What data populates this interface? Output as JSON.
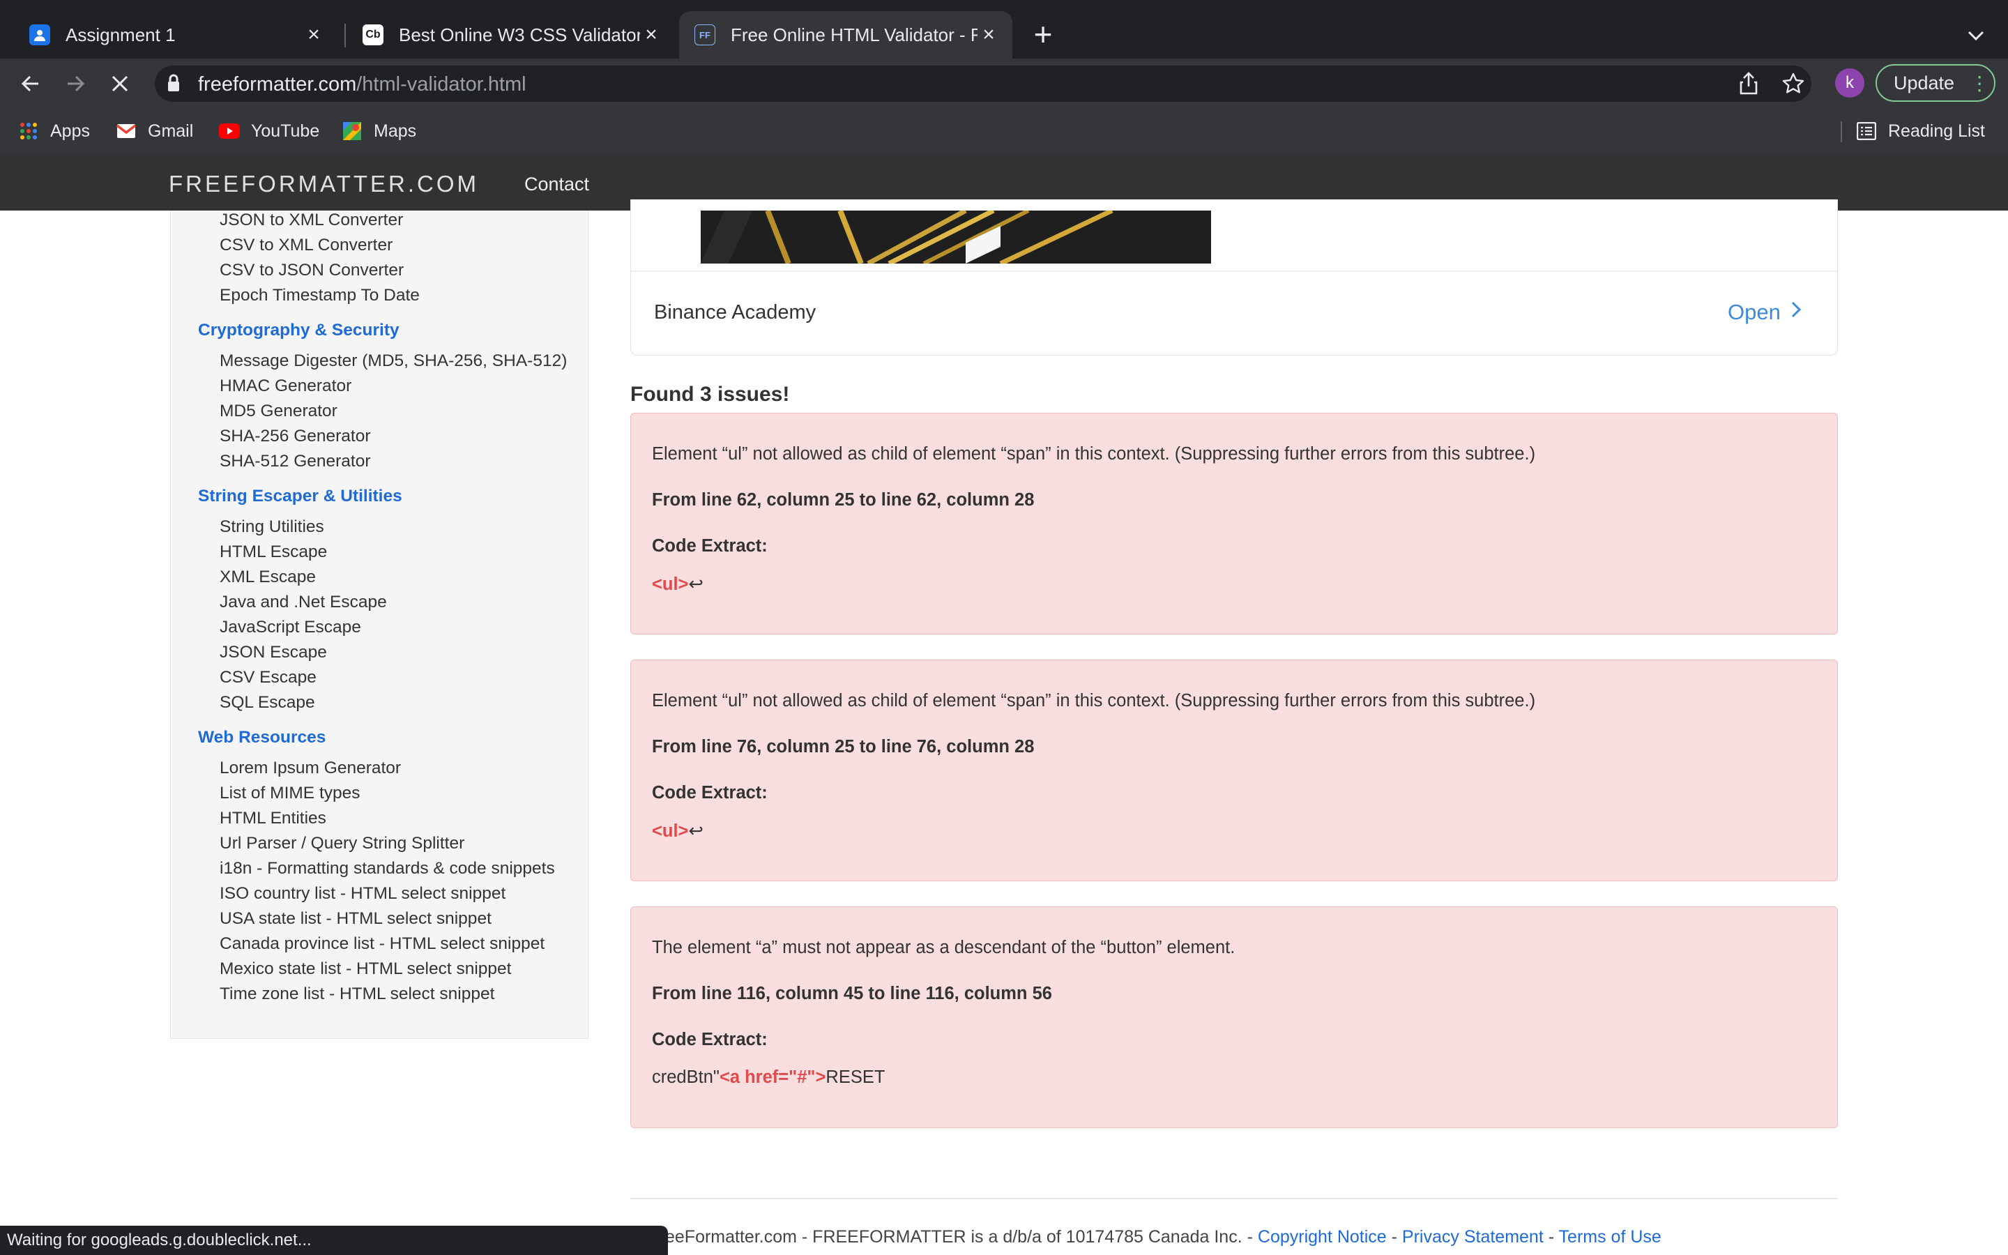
{
  "browser": {
    "tabs": [
      {
        "title": "Assignment 1",
        "active": false
      },
      {
        "title": "Best Online W3 CSS Validator",
        "favicon_text": "Cb",
        "active": false
      },
      {
        "title": "Free Online HTML Validator - F",
        "favicon_text": "FF",
        "active": true
      }
    ],
    "url_domain": "freeformatter.com",
    "url_path": "/html-validator.html",
    "profile_initial": "k",
    "update_label": "Update",
    "bookmarks": [
      "Apps",
      "Gmail",
      "YouTube",
      "Maps"
    ],
    "reading_list": "Reading List",
    "status_text": "Waiting for googleads.g.doubleclick.net..."
  },
  "site": {
    "brand": "FREEFORMATTER.COM",
    "nav_contact": "Contact"
  },
  "sidebar": {
    "top_items": [
      "JSON to XML Converter",
      "CSV to XML Converter",
      "CSV to JSON Converter",
      "Epoch Timestamp To Date"
    ],
    "sections": [
      {
        "title": "Cryptography & Security",
        "items": [
          "Message Digester (MD5, SHA-256, SHA-512)",
          "HMAC Generator",
          "MD5 Generator",
          "SHA-256 Generator",
          "SHA-512 Generator"
        ]
      },
      {
        "title": "String Escaper & Utilities",
        "items": [
          "String Utilities",
          "HTML Escape",
          "XML Escape",
          "Java and .Net Escape",
          "JavaScript Escape",
          "JSON Escape",
          "CSV Escape",
          "SQL Escape"
        ]
      },
      {
        "title": "Web Resources",
        "items": [
          "Lorem Ipsum Generator",
          "List of MIME types",
          "HTML Entities",
          "Url Parser / Query String Splitter",
          "i18n - Formatting standards & code snippets",
          "ISO country list - HTML select snippet",
          "USA state list - HTML select snippet",
          "Canada province list - HTML select snippet",
          "Mexico state list - HTML select snippet",
          "Time zone list - HTML select snippet"
        ]
      }
    ]
  },
  "ad": {
    "advertiser": "Binance Academy",
    "cta": "Open"
  },
  "results": {
    "summary": "Found 3 issues!",
    "code_extract_label": "Code Extract:",
    "issues": [
      {
        "message": "Element “ul” not allowed as child of element “span” in this context. (Suppressing further errors from this subtree.)",
        "location": "From line 62, column 25 to line 62, column 28",
        "code_prefix": "",
        "code_tag": "<ul>",
        "code_suffix": "↩"
      },
      {
        "message": "Element “ul” not allowed as child of element “span” in this context. (Suppressing further errors from this subtree.)",
        "location": "From line 76, column 25 to line 76, column 28",
        "code_prefix": "",
        "code_tag": "<ul>",
        "code_suffix": "↩"
      },
      {
        "message": "The element “a” must not appear as a descendant of the “button” element.",
        "location": "From line 116, column 45 to line 116, column 56",
        "code_prefix": "credBtn\"",
        "code_tag": "<a href=\"#\">",
        "code_suffix": "RESET"
      }
    ]
  },
  "footer": {
    "text": "eeFormatter.com - FREEFORMATTER is a d/b/a of 10174785 Canada Inc. - ",
    "links": [
      "Copyright Notice",
      "Privacy Statement",
      "Terms of Use"
    ],
    "sep": " - "
  },
  "colors": {
    "accent_link": "#1e6bd6",
    "issue_bg": "#f8dede",
    "issue_tag": "#e04a4a",
    "update_border": "#81c995"
  }
}
